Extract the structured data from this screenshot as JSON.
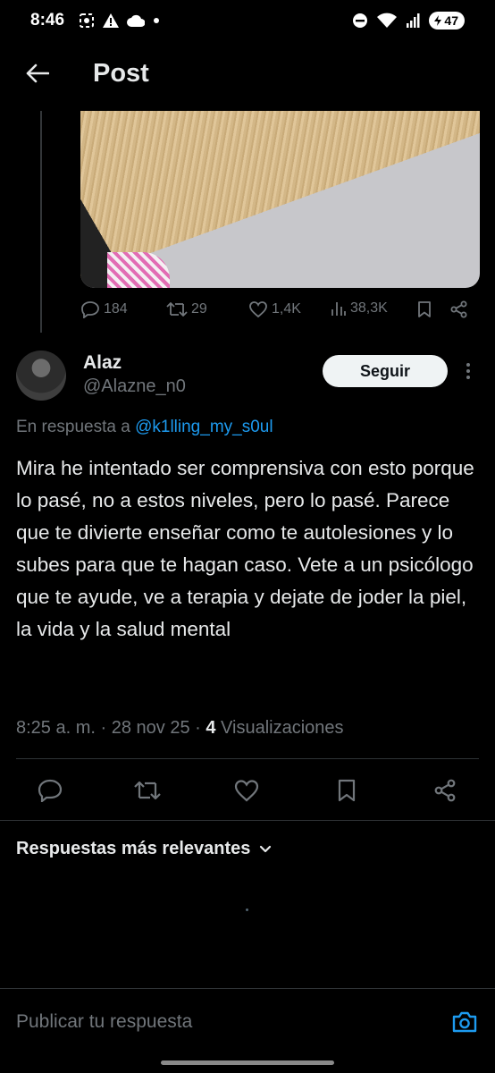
{
  "status_bar": {
    "time": "8:46",
    "battery": "47",
    "icons": [
      "screenshot-icon",
      "alert-icon",
      "cloud-icon",
      "dot-icon",
      "dnd-icon",
      "wifi-icon",
      "signal-icon",
      "battery-icon"
    ]
  },
  "header": {
    "title": "Post"
  },
  "previous_tweet": {
    "metrics": {
      "replies": "184",
      "reposts": "29",
      "likes": "1,4K",
      "views": "38,3K"
    }
  },
  "tweet": {
    "author_name": "Alaz",
    "author_handle": "@Alazne_n0",
    "follow_label": "Seguir",
    "reply_prefix": "En respuesta a",
    "reply_mention": "@k1lling_my_s0ul",
    "text": "Mira he intentado ser comprensiva con esto porque lo pasé, no a estos niveles, pero lo pasé. Parece que te divierte enseñar como te autolesiones y lo subes para que te hagan caso. Vete a un psicólogo que te ayude, ve a terapia y dejate de joder la piel, la vida y la salud mental",
    "time": "8:25 a. m.",
    "date": "28 nov 25",
    "view_count": "4",
    "views_label": "Visualizaciones"
  },
  "replies": {
    "filter_label": "Respuestas más relevantes"
  },
  "composer": {
    "placeholder": "Publicar tu respuesta"
  },
  "colors": {
    "background": "#000000",
    "accent": "#1d9bf0",
    "text": "#e7e9ea",
    "muted": "#71767b"
  }
}
